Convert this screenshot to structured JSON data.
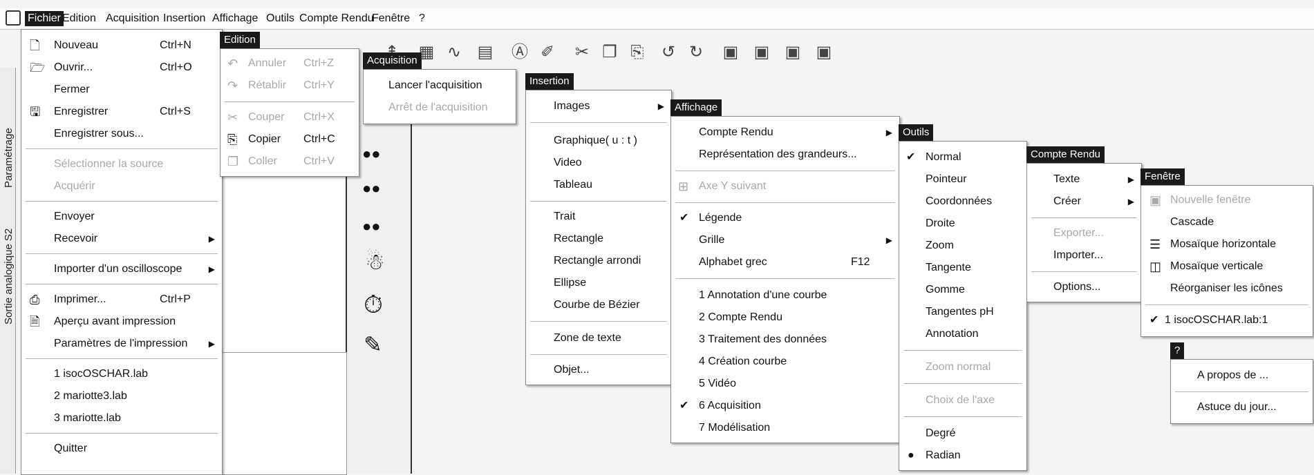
{
  "menubar": {
    "items": [
      "Fichier",
      "Edition",
      "Acquisition",
      "Insertion",
      "Affichage",
      "Outils",
      "Compte Rendu",
      "Fenêtre",
      "?"
    ]
  },
  "side_tabs": [
    "Paramétrage",
    "Sortie analogique S2"
  ],
  "menus": {
    "fichier": {
      "items": [
        {
          "label": "Nouveau",
          "shortcut": "Ctrl+N",
          "icon": "new-document-icon"
        },
        {
          "label": "Ouvrir...",
          "shortcut": "Ctrl+O",
          "icon": "open-folder-icon"
        },
        {
          "label": "Fermer",
          "shortcut": ""
        },
        {
          "label": "Enregistrer",
          "shortcut": "Ctrl+S",
          "icon": "save-icon"
        },
        {
          "label": "Enregistrer sous...",
          "shortcut": ""
        },
        {
          "label": "Sélectionner la source",
          "disabled": true
        },
        {
          "label": "Acquérir",
          "disabled": true
        },
        {
          "label": "Envoyer"
        },
        {
          "label": "Recevoir",
          "submenu": true
        },
        {
          "label": "Importer d'un oscilloscope",
          "submenu": true
        },
        {
          "label": "Imprimer...",
          "shortcut": "Ctrl+P",
          "icon": "printer-icon"
        },
        {
          "label": "Aperçu avant impression",
          "icon": "print-preview-icon"
        },
        {
          "label": "Paramètres de l'impression",
          "submenu": true
        },
        {
          "label": "1 isocOSCHAR.lab"
        },
        {
          "label": "2 mariotte3.lab"
        },
        {
          "label": "3 mariotte.lab"
        },
        {
          "label": "Quitter"
        }
      ]
    },
    "edition": {
      "title": "Edition",
      "items": [
        {
          "label": "Annuler",
          "shortcut": "Ctrl+Z",
          "disabled": true
        },
        {
          "label": "Rétablir",
          "shortcut": "Ctrl+Y",
          "disabled": true
        },
        {
          "label": "Couper",
          "shortcut": "Ctrl+X",
          "disabled": true
        },
        {
          "label": "Copier",
          "shortcut": "Ctrl+C"
        },
        {
          "label": "Coller",
          "shortcut": "Ctrl+V",
          "disabled": true
        }
      ]
    },
    "acquisition": {
      "title": "Acquisition",
      "items": [
        {
          "label": "Lancer l'acquisition"
        },
        {
          "label": "Arrêt de l'acquisition",
          "disabled": true
        }
      ]
    },
    "insertion": {
      "title": "Insertion",
      "items": [
        {
          "label": "Images",
          "submenu": true
        },
        {
          "label": "Graphique( u : t )"
        },
        {
          "label": "Video"
        },
        {
          "label": "Tableau"
        },
        {
          "label": "Trait"
        },
        {
          "label": "Rectangle"
        },
        {
          "label": "Rectangle arrondi"
        },
        {
          "label": "Ellipse"
        },
        {
          "label": "Courbe de Bézier"
        },
        {
          "label": "Zone de texte"
        },
        {
          "label": "Objet..."
        }
      ]
    },
    "affichage": {
      "title": "Affichage",
      "items": [
        {
          "label": "Compte Rendu",
          "submenu": true
        },
        {
          "label": "Représentation des grandeurs..."
        },
        {
          "label": "Axe Y suivant",
          "disabled": true
        },
        {
          "label": "Légende",
          "checked": true
        },
        {
          "label": "Grille",
          "submenu": true
        },
        {
          "label": "Alphabet grec",
          "shortcut": "F12"
        },
        {
          "label": "1 Annotation d'une courbe"
        },
        {
          "label": "2 Compte Rendu"
        },
        {
          "label": "3 Traitement des données"
        },
        {
          "label": "4 Création courbe"
        },
        {
          "label": "5 Vidéo"
        },
        {
          "label": "6 Acquisition",
          "checked": true
        },
        {
          "label": "7 Modélisation"
        }
      ]
    },
    "outils": {
      "title": "Outils",
      "items": [
        {
          "label": "Normal",
          "checked": true
        },
        {
          "label": "Pointeur"
        },
        {
          "label": "Coordonnées"
        },
        {
          "label": "Droite"
        },
        {
          "label": "Zoom"
        },
        {
          "label": "Tangente"
        },
        {
          "label": "Gomme"
        },
        {
          "label": "Tangentes pH"
        },
        {
          "label": "Annotation"
        },
        {
          "label": "Zoom normal",
          "disabled": true
        },
        {
          "label": "Choix de l'axe",
          "disabled": true
        },
        {
          "label": "Degré"
        },
        {
          "label": "Radian",
          "radio": true
        }
      ]
    },
    "compte_rendu": {
      "title": "Compte Rendu",
      "items": [
        {
          "label": "Texte",
          "submenu": true
        },
        {
          "label": "Créer",
          "submenu": true
        },
        {
          "label": "Exporter...",
          "disabled": true
        },
        {
          "label": "Importer..."
        },
        {
          "label": "Options..."
        }
      ]
    },
    "fenetre": {
      "title": "Fenêtre",
      "items": [
        {
          "label": "Nouvelle fenêtre",
          "disabled": true
        },
        {
          "label": "Cascade"
        },
        {
          "label": "Mosaïque horizontale"
        },
        {
          "label": "Mosaïque verticale"
        },
        {
          "label": "Réorganiser les icônes"
        },
        {
          "label": "1 isocOSCHAR.lab:1",
          "checked": true
        }
      ]
    },
    "aide": {
      "title": "?",
      "items": [
        {
          "label": "A propos de ..."
        },
        {
          "label": "Astuce du jour..."
        }
      ]
    }
  }
}
